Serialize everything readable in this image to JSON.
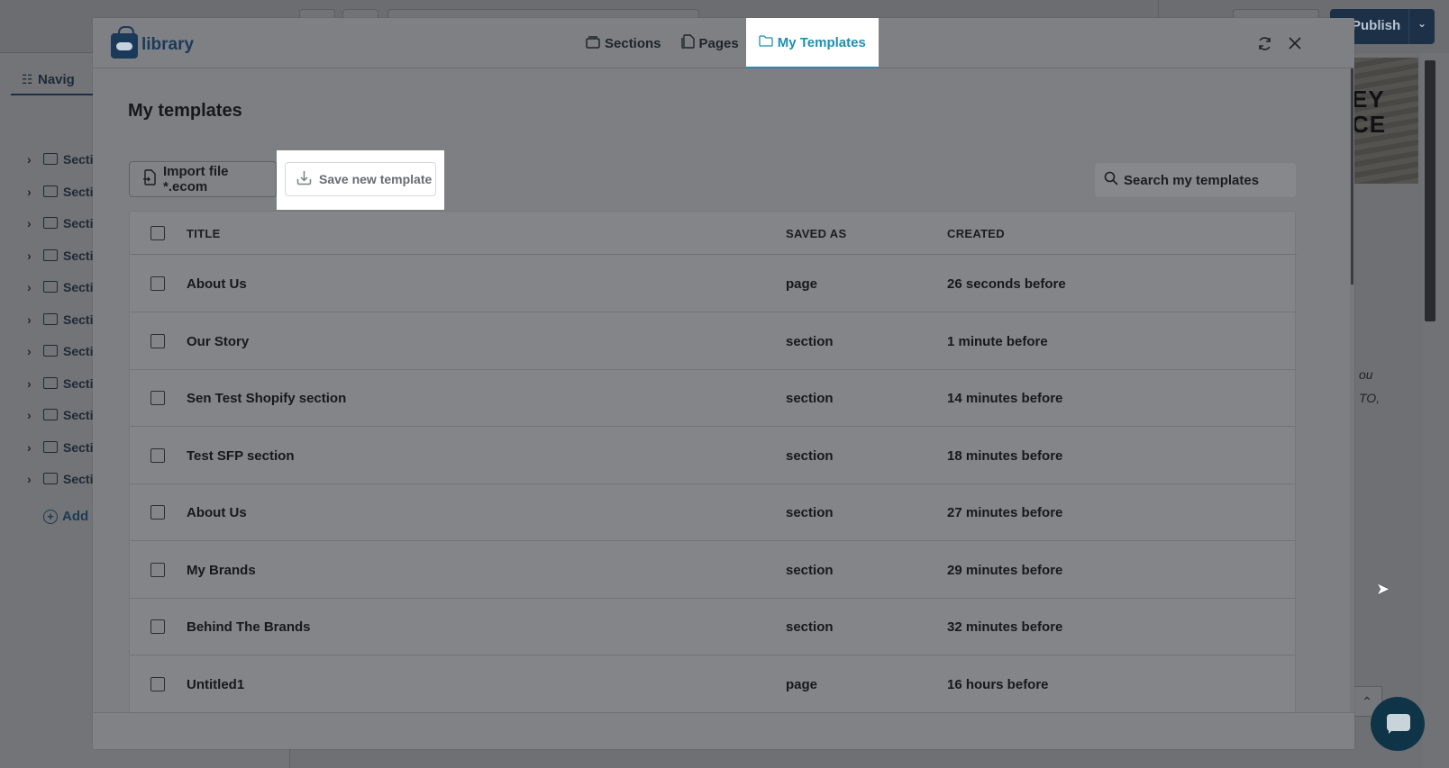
{
  "background": {
    "nav_tab_label": "Navig",
    "section_label": "Secti",
    "section_count": 11,
    "add_label": "Add s",
    "publish_label": "Publish",
    "canvas_heading": [
      "EY",
      "CE"
    ],
    "canvas_italic": [
      "ou",
      "TO,"
    ]
  },
  "modal": {
    "logo_text": "library",
    "tabs": [
      {
        "label": "Sections",
        "icon": "layers-icon",
        "active": false
      },
      {
        "label": "Pages",
        "icon": "pages-icon",
        "active": false
      },
      {
        "label": "My Templates",
        "icon": "folder-icon",
        "active": true
      }
    ],
    "title": "My templates",
    "import_label": "Import file *.ecom",
    "save_label": "Save new template",
    "search_placeholder": "Search my templates",
    "columns": {
      "title": "TITLE",
      "saved_as": "SAVED AS",
      "created": "CREATED"
    },
    "rows": [
      {
        "title": "About Us",
        "saved_as": "page",
        "created": "26 seconds before"
      },
      {
        "title": "Our Story",
        "saved_as": "section",
        "created": "1 minute before"
      },
      {
        "title": "Sen Test Shopify section",
        "saved_as": "section",
        "created": "14 minutes before"
      },
      {
        "title": "Test SFP section",
        "saved_as": "section",
        "created": "18 minutes before"
      },
      {
        "title": "About Us",
        "saved_as": "section",
        "created": "27 minutes before"
      },
      {
        "title": "My Brands",
        "saved_as": "section",
        "created": "29 minutes before"
      },
      {
        "title": "Behind The Brands",
        "saved_as": "section",
        "created": "32 minutes before"
      },
      {
        "title": "Untitled1",
        "saved_as": "page",
        "created": "16 hours before"
      }
    ]
  },
  "colors": {
    "accent": "#1f8fb0",
    "brand": "#1b3a59",
    "overlay": "#7d7f82"
  }
}
